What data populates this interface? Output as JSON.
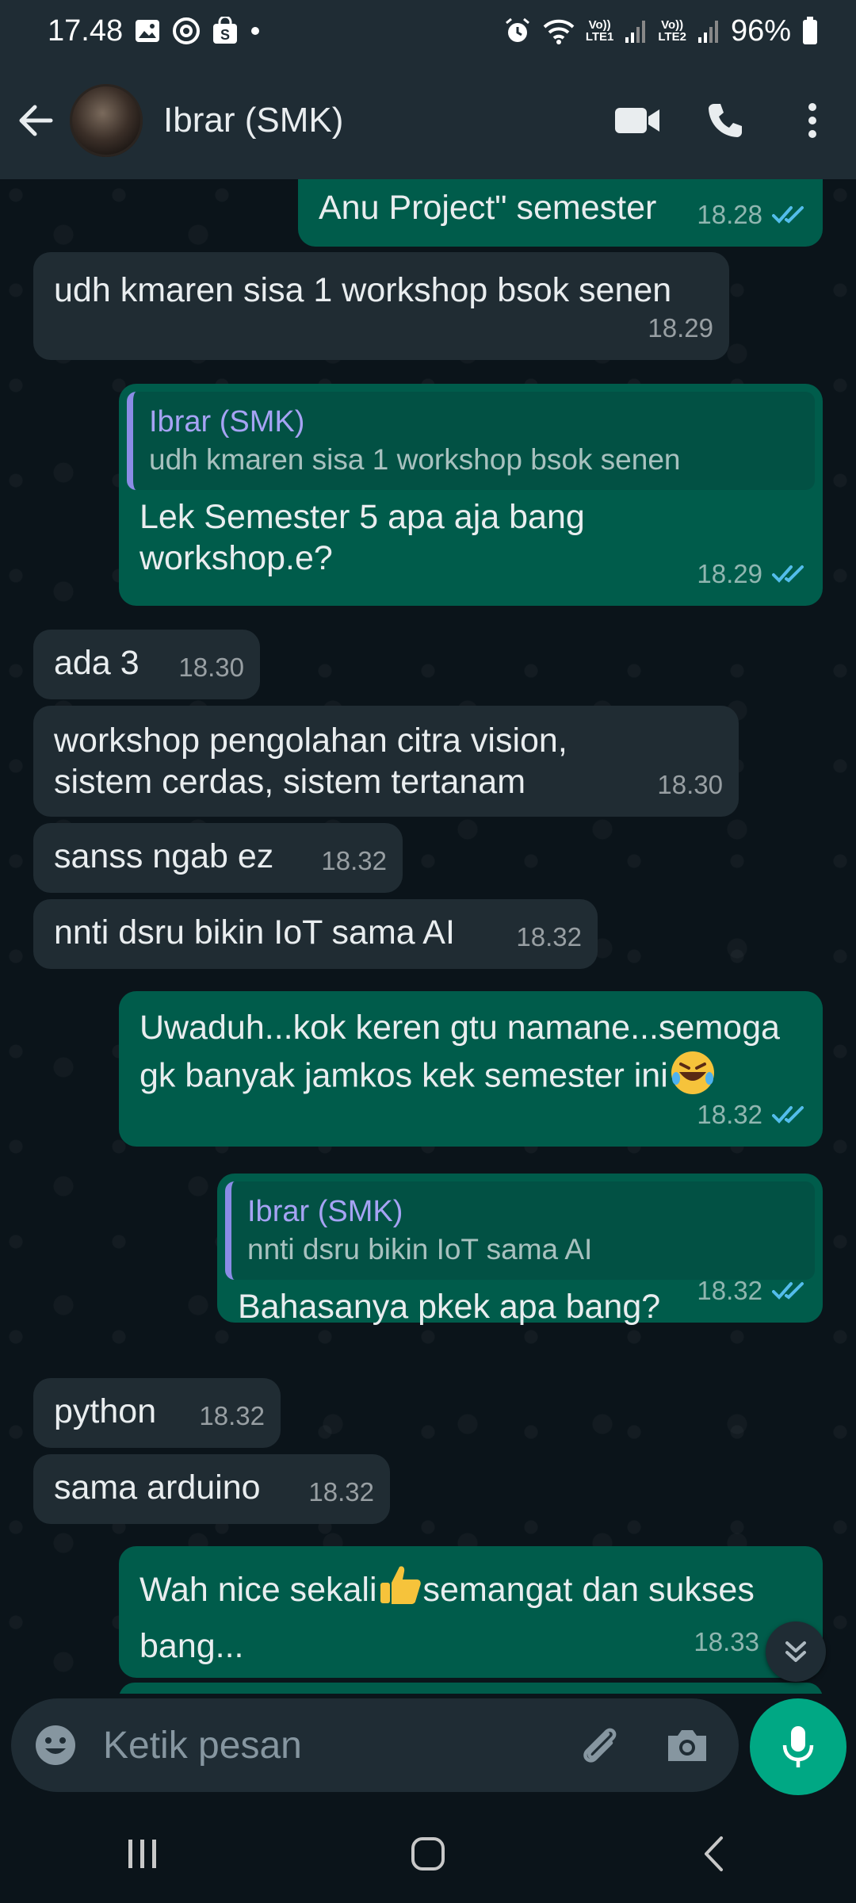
{
  "status_bar": {
    "time": "17.48",
    "net1": [
      "Vo))",
      "LTE1"
    ],
    "net2": [
      "Vo))",
      "LTE2"
    ],
    "battery": "96%"
  },
  "header": {
    "contact_name": "Ibrar (SMK)",
    "icons": [
      "back-arrow-icon",
      "video-call-icon",
      "voice-call-icon",
      "more-options-icon"
    ]
  },
  "messages": [
    {
      "dir": "out",
      "text": "Anu Project\" semester",
      "time": "18.28",
      "read": true
    },
    {
      "dir": "in",
      "text": "udh kmaren sisa 1 workshop bsok senen",
      "time": "18.29"
    },
    {
      "dir": "out",
      "quote": {
        "name": "Ibrar (SMK)",
        "text": "udh kmaren sisa 1 workshop bsok senen"
      },
      "text": "Lek Semester 5 apa aja bang workshop.e?",
      "time": "18.29",
      "read": true
    },
    {
      "dir": "in",
      "text": "ada 3",
      "time": "18.30"
    },
    {
      "dir": "in",
      "text": "workshop pengolahan citra vision, sistem cerdas, sistem tertanam",
      "time": "18.30"
    },
    {
      "dir": "in",
      "text": "sanss ngab ez",
      "time": "18.32"
    },
    {
      "dir": "in",
      "text": "nnti dsru bikin IoT sama AI",
      "time": "18.32"
    },
    {
      "dir": "out",
      "text": "Uwaduh...kok keren gtu namane...semoga gk banyak jamkos kek semester ini",
      "emoji": "🤣",
      "time": "18.32",
      "read": true
    },
    {
      "dir": "out",
      "quote": {
        "name": "Ibrar (SMK)",
        "text": "nnti dsru bikin IoT sama AI"
      },
      "text": "Bahasanya pkek apa bang?",
      "time": "18.32",
      "read": true
    },
    {
      "dir": "in",
      "text": "python",
      "time": "18.32"
    },
    {
      "dir": "in",
      "text": "sama arduino",
      "time": "18.32"
    },
    {
      "dir": "out",
      "text_before": "Wah nice sekali",
      "emoji": "👍",
      "text_after": "semangat dan sukses bang...",
      "time": "18.33"
    }
  ],
  "composer": {
    "placeholder": "Ketik pesan"
  },
  "colors": {
    "incoming": "#202c33",
    "outgoing": "#005c4b",
    "accent": "#00a884",
    "read_tick": "#53bdeb"
  }
}
